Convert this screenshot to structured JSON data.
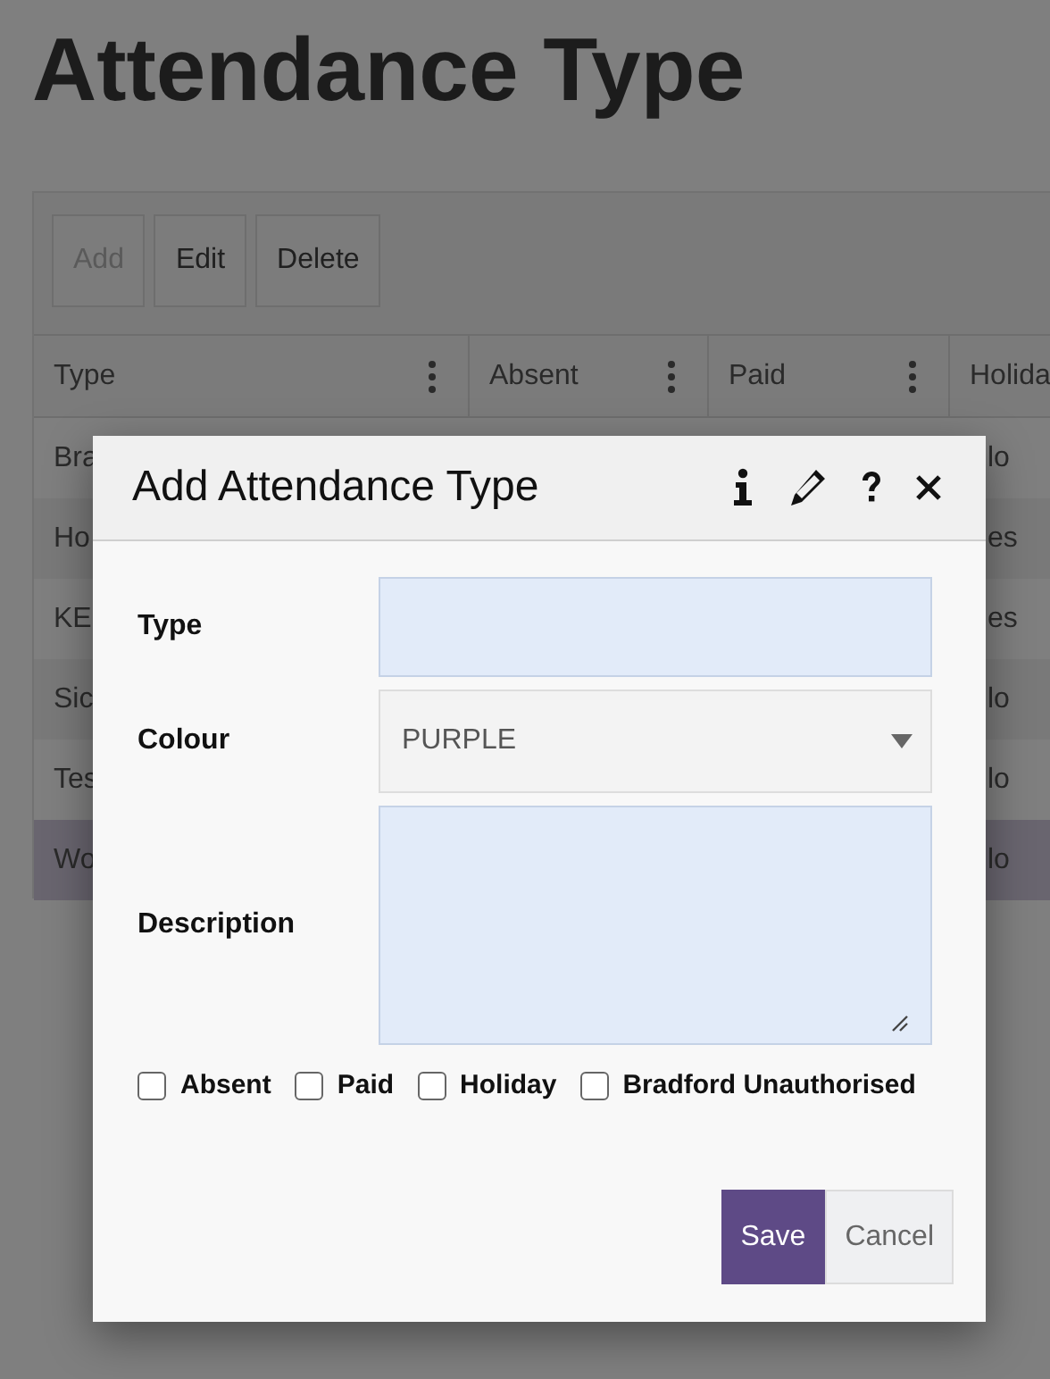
{
  "page_title": "Attendance Type",
  "toolbar": [
    {
      "label": "Add",
      "disabled": true
    },
    {
      "label": "Edit",
      "disabled": false
    },
    {
      "label": "Delete",
      "disabled": false
    }
  ],
  "table": {
    "columns": [
      "Type",
      "Absent",
      "Paid",
      "Holida"
    ],
    "rows": [
      {
        "type": "Bra",
        "holiday": "lo",
        "selected": false
      },
      {
        "type": "Ho",
        "holiday": "es",
        "selected": false
      },
      {
        "type": "KE",
        "holiday": "es",
        "selected": false
      },
      {
        "type": "Sic",
        "holiday": "lo",
        "selected": false
      },
      {
        "type": "Tes",
        "holiday": "lo",
        "selected": false
      },
      {
        "type": "Wo",
        "holiday": "lo",
        "selected": true
      }
    ]
  },
  "dialog": {
    "title": "Add Attendance Type",
    "fields": [
      {
        "label": "Type",
        "kind": "text"
      },
      {
        "label": "Colour",
        "kind": "select",
        "value": "PURPLE"
      },
      {
        "label": "Description",
        "kind": "textarea"
      }
    ],
    "checkboxes": [
      {
        "label": "Absent",
        "checked": false
      },
      {
        "label": "Paid",
        "checked": false
      },
      {
        "label": "Holiday",
        "checked": false
      },
      {
        "label": "Bradford Unauthorised",
        "checked": false
      }
    ],
    "buttons": [
      {
        "label": "Save",
        "kind": "primary"
      },
      {
        "label": "Cancel",
        "kind": "secondary"
      }
    ]
  }
}
